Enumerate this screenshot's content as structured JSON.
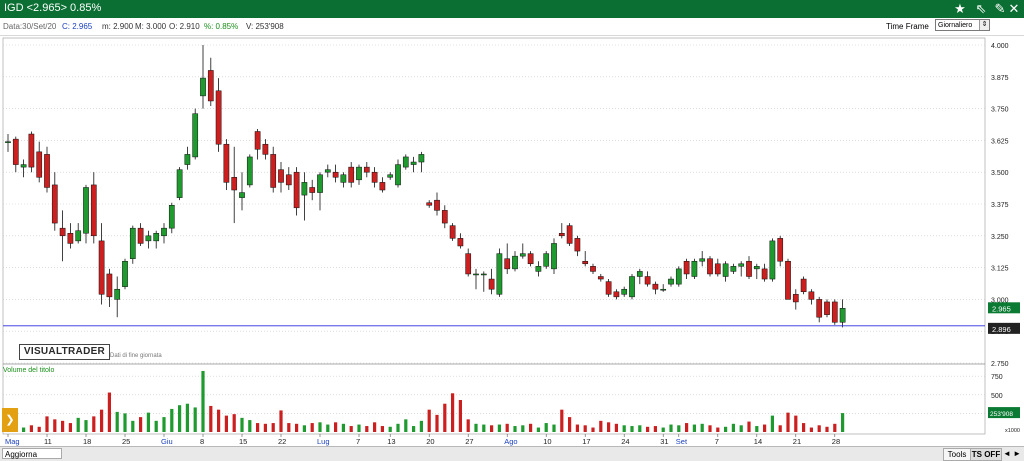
{
  "title": {
    "text": "IGD <2.965> 0.85%"
  },
  "infobar": {
    "date": "Data:30/Set/20",
    "close": "C: 2.965",
    "min": "m: 2.900",
    "max": "M: 3.000",
    "open": "O: 2.910",
    "pct": "%: 0.85%",
    "vol": "V: 253'908"
  },
  "timeframe": {
    "label": "Time Frame",
    "value": "Giornaliero"
  },
  "brand": {
    "name": "VISUALTRADER",
    "subtitle": "Dati di fine giornata"
  },
  "volume_label": "Volume del titolo",
  "price_axis": {
    "ticks": [
      "4.000",
      "3.875",
      "3.750",
      "3.625",
      "3.500",
      "3.375",
      "3.250",
      "3.125",
      "3.000",
      "2.875",
      "2.750"
    ]
  },
  "volume_axis": {
    "ticks": [
      "750",
      "500",
      "250"
    ],
    "unit": "x1000",
    "last_value": "253'908"
  },
  "tags": {
    "last_price": "2.965",
    "crosshair_price": "2.896"
  },
  "date_labels": [
    {
      "t": "Mag",
      "i": 0,
      "month": true
    },
    {
      "t": "11",
      "i": 5
    },
    {
      "t": "18",
      "i": 10
    },
    {
      "t": "25",
      "i": 15
    },
    {
      "t": "Giu",
      "i": 20,
      "month": true
    },
    {
      "t": "8",
      "i": 25
    },
    {
      "t": "15",
      "i": 30
    },
    {
      "t": "22",
      "i": 35
    },
    {
      "t": "Lug",
      "i": 40,
      "month": true
    },
    {
      "t": "7",
      "i": 45
    },
    {
      "t": "13",
      "i": 49
    },
    {
      "t": "20",
      "i": 54
    },
    {
      "t": "27",
      "i": 59
    },
    {
      "t": "Ago",
      "i": 64,
      "month": true
    },
    {
      "t": "10",
      "i": 69
    },
    {
      "t": "17",
      "i": 74
    },
    {
      "t": "24",
      "i": 79
    },
    {
      "t": "31",
      "i": 84
    },
    {
      "t": "Set",
      "i": 86,
      "month": true
    },
    {
      "t": "7",
      "i": 91
    },
    {
      "t": "14",
      "i": 96
    },
    {
      "t": "21",
      "i": 101
    },
    {
      "t": "28",
      "i": 106
    }
  ],
  "bottombar": {
    "aggiorna": "Aggiorna",
    "tools": "Tools",
    "ts_off": "TS OFF",
    "arrows": "◄ ►"
  },
  "colors": {
    "up": "#1e9a2f",
    "down": "#cc1f1f",
    "titlebar": "#0b6f33",
    "crosshair": "#2a2adf",
    "grid": "#c8c8c8"
  },
  "chart_data": {
    "type": "candlestick",
    "ylim": [
      2.75,
      4.0
    ],
    "volume_ylim": [
      0,
      900
    ],
    "candles": [
      {
        "o": 3.62,
        "h": 3.65,
        "l": 3.58,
        "c": 3.62,
        "v": 120
      },
      {
        "o": 3.63,
        "h": 3.64,
        "l": 3.5,
        "c": 3.53,
        "v": 40
      },
      {
        "o": 3.52,
        "h": 3.55,
        "l": 3.48,
        "c": 3.53,
        "v": 60
      },
      {
        "o": 3.65,
        "h": 3.66,
        "l": 3.5,
        "c": 3.52,
        "v": 90
      },
      {
        "o": 3.58,
        "h": 3.62,
        "l": 3.46,
        "c": 3.48,
        "v": 70
      },
      {
        "o": 3.57,
        "h": 3.6,
        "l": 3.42,
        "c": 3.44,
        "v": 210
      },
      {
        "o": 3.45,
        "h": 3.5,
        "l": 3.27,
        "c": 3.3,
        "v": 170
      },
      {
        "o": 3.28,
        "h": 3.35,
        "l": 3.15,
        "c": 3.25,
        "v": 150
      },
      {
        "o": 3.26,
        "h": 3.3,
        "l": 3.2,
        "c": 3.22,
        "v": 120
      },
      {
        "o": 3.23,
        "h": 3.3,
        "l": 3.22,
        "c": 3.27,
        "v": 190
      },
      {
        "o": 3.26,
        "h": 3.45,
        "l": 3.22,
        "c": 3.44,
        "v": 160
      },
      {
        "o": 3.45,
        "h": 3.5,
        "l": 3.22,
        "c": 3.25,
        "v": 210
      },
      {
        "o": 3.23,
        "h": 3.3,
        "l": 2.98,
        "c": 3.02,
        "v": 300
      },
      {
        "o": 3.1,
        "h": 3.12,
        "l": 2.97,
        "c": 3.01,
        "v": 530
      },
      {
        "o": 3.0,
        "h": 3.09,
        "l": 2.93,
        "c": 3.04,
        "v": 270
      },
      {
        "o": 3.05,
        "h": 3.16,
        "l": 3.04,
        "c": 3.15,
        "v": 250
      },
      {
        "o": 3.16,
        "h": 3.29,
        "l": 3.14,
        "c": 3.28,
        "v": 150
      },
      {
        "o": 3.28,
        "h": 3.3,
        "l": 3.21,
        "c": 3.22,
        "v": 200
      },
      {
        "o": 3.23,
        "h": 3.27,
        "l": 3.2,
        "c": 3.25,
        "v": 260
      },
      {
        "o": 3.23,
        "h": 3.27,
        "l": 3.2,
        "c": 3.26,
        "v": 150
      },
      {
        "o": 3.25,
        "h": 3.3,
        "l": 3.22,
        "c": 3.28,
        "v": 200
      },
      {
        "o": 3.28,
        "h": 3.38,
        "l": 3.26,
        "c": 3.37,
        "v": 310
      },
      {
        "o": 3.4,
        "h": 3.52,
        "l": 3.39,
        "c": 3.51,
        "v": 360
      },
      {
        "o": 3.53,
        "h": 3.6,
        "l": 3.51,
        "c": 3.57,
        "v": 380
      },
      {
        "o": 3.56,
        "h": 3.75,
        "l": 3.55,
        "c": 3.73,
        "v": 330
      },
      {
        "o": 3.8,
        "h": 4.0,
        "l": 3.75,
        "c": 3.87,
        "v": 820
      },
      {
        "o": 3.9,
        "h": 3.95,
        "l": 3.76,
        "c": 3.78,
        "v": 350
      },
      {
        "o": 3.82,
        "h": 3.87,
        "l": 3.58,
        "c": 3.61,
        "v": 300
      },
      {
        "o": 3.61,
        "h": 3.63,
        "l": 3.43,
        "c": 3.46,
        "v": 220
      },
      {
        "o": 3.48,
        "h": 3.6,
        "l": 3.3,
        "c": 3.43,
        "v": 240
      },
      {
        "o": 3.4,
        "h": 3.5,
        "l": 3.35,
        "c": 3.42,
        "v": 190
      },
      {
        "o": 3.45,
        "h": 3.57,
        "l": 3.44,
        "c": 3.56,
        "v": 160
      },
      {
        "o": 3.66,
        "h": 3.67,
        "l": 3.55,
        "c": 3.59,
        "v": 120
      },
      {
        "o": 3.61,
        "h": 3.63,
        "l": 3.55,
        "c": 3.57,
        "v": 110
      },
      {
        "o": 3.57,
        "h": 3.6,
        "l": 3.42,
        "c": 3.44,
        "v": 120
      },
      {
        "o": 3.51,
        "h": 3.54,
        "l": 3.42,
        "c": 3.46,
        "v": 290
      },
      {
        "o": 3.49,
        "h": 3.52,
        "l": 3.43,
        "c": 3.45,
        "v": 120
      },
      {
        "o": 3.5,
        "h": 3.52,
        "l": 3.33,
        "c": 3.36,
        "v": 110
      },
      {
        "o": 3.41,
        "h": 3.5,
        "l": 3.31,
        "c": 3.46,
        "v": 90
      },
      {
        "o": 3.44,
        "h": 3.47,
        "l": 3.39,
        "c": 3.42,
        "v": 120
      },
      {
        "o": 3.42,
        "h": 3.5,
        "l": 3.35,
        "c": 3.49,
        "v": 130
      },
      {
        "o": 3.5,
        "h": 3.53,
        "l": 3.48,
        "c": 3.51,
        "v": 100
      },
      {
        "o": 3.5,
        "h": 3.53,
        "l": 3.46,
        "c": 3.48,
        "v": 130
      },
      {
        "o": 3.46,
        "h": 3.5,
        "l": 3.44,
        "c": 3.49,
        "v": 110
      },
      {
        "o": 3.52,
        "h": 3.54,
        "l": 3.44,
        "c": 3.46,
        "v": 80
      },
      {
        "o": 3.47,
        "h": 3.53,
        "l": 3.45,
        "c": 3.52,
        "v": 100
      },
      {
        "o": 3.52,
        "h": 3.54,
        "l": 3.48,
        "c": 3.5,
        "v": 80
      },
      {
        "o": 3.5,
        "h": 3.52,
        "l": 3.44,
        "c": 3.46,
        "v": 130
      },
      {
        "o": 3.46,
        "h": 3.48,
        "l": 3.42,
        "c": 3.43,
        "v": 80
      },
      {
        "o": 3.48,
        "h": 3.5,
        "l": 3.47,
        "c": 3.49,
        "v": 70
      },
      {
        "o": 3.45,
        "h": 3.55,
        "l": 3.44,
        "c": 3.53,
        "v": 110
      },
      {
        "o": 3.52,
        "h": 3.57,
        "l": 3.51,
        "c": 3.56,
        "v": 170
      },
      {
        "o": 3.53,
        "h": 3.56,
        "l": 3.5,
        "c": 3.54,
        "v": 80
      },
      {
        "o": 3.54,
        "h": 3.58,
        "l": 3.5,
        "c": 3.57,
        "v": 150
      },
      {
        "o": 3.38,
        "h": 3.39,
        "l": 3.36,
        "c": 3.37,
        "v": 300
      },
      {
        "o": 3.39,
        "h": 3.42,
        "l": 3.33,
        "c": 3.35,
        "v": 230
      },
      {
        "o": 3.35,
        "h": 3.37,
        "l": 3.28,
        "c": 3.3,
        "v": 380
      },
      {
        "o": 3.29,
        "h": 3.3,
        "l": 3.23,
        "c": 3.24,
        "v": 520
      },
      {
        "o": 3.24,
        "h": 3.26,
        "l": 3.2,
        "c": 3.21,
        "v": 430
      },
      {
        "o": 3.18,
        "h": 3.2,
        "l": 3.09,
        "c": 3.1,
        "v": 170
      },
      {
        "o": 3.1,
        "h": 3.12,
        "l": 3.04,
        "c": 3.1,
        "v": 110
      },
      {
        "o": 3.1,
        "h": 3.11,
        "l": 3.03,
        "c": 3.1,
        "v": 100
      },
      {
        "o": 3.08,
        "h": 3.12,
        "l": 3.02,
        "c": 3.04,
        "v": 90
      },
      {
        "o": 3.02,
        "h": 3.2,
        "l": 3.01,
        "c": 3.18,
        "v": 100
      },
      {
        "o": 3.16,
        "h": 3.22,
        "l": 3.1,
        "c": 3.12,
        "v": 110
      },
      {
        "o": 3.12,
        "h": 3.19,
        "l": 3.11,
        "c": 3.17,
        "v": 80
      },
      {
        "o": 3.17,
        "h": 3.22,
        "l": 3.16,
        "c": 3.18,
        "v": 90
      },
      {
        "o": 3.18,
        "h": 3.19,
        "l": 3.13,
        "c": 3.14,
        "v": 110
      },
      {
        "o": 3.11,
        "h": 3.15,
        "l": 3.09,
        "c": 3.13,
        "v": 60
      },
      {
        "o": 3.13,
        "h": 3.19,
        "l": 3.12,
        "c": 3.18,
        "v": 120
      },
      {
        "o": 3.12,
        "h": 3.24,
        "l": 3.1,
        "c": 3.22,
        "v": 100
      },
      {
        "o": 3.26,
        "h": 3.3,
        "l": 3.24,
        "c": 3.25,
        "v": 300
      },
      {
        "o": 3.29,
        "h": 3.3,
        "l": 3.21,
        "c": 3.22,
        "v": 200
      },
      {
        "o": 3.24,
        "h": 3.25,
        "l": 3.17,
        "c": 3.19,
        "v": 100
      },
      {
        "o": 3.15,
        "h": 3.19,
        "l": 3.13,
        "c": 3.14,
        "v": 90
      },
      {
        "o": 3.13,
        "h": 3.14,
        "l": 3.1,
        "c": 3.11,
        "v": 60
      },
      {
        "o": 3.09,
        "h": 3.1,
        "l": 3.07,
        "c": 3.08,
        "v": 150
      },
      {
        "o": 3.07,
        "h": 3.08,
        "l": 3.01,
        "c": 3.02,
        "v": 130
      },
      {
        "o": 3.03,
        "h": 3.04,
        "l": 3.0,
        "c": 3.01,
        "v": 110
      },
      {
        "o": 3.02,
        "h": 3.05,
        "l": 3.01,
        "c": 3.04,
        "v": 90
      },
      {
        "o": 3.01,
        "h": 3.1,
        "l": 3.0,
        "c": 3.09,
        "v": 80
      },
      {
        "o": 3.09,
        "h": 3.12,
        "l": 3.06,
        "c": 3.11,
        "v": 90
      },
      {
        "o": 3.09,
        "h": 3.11,
        "l": 3.05,
        "c": 3.06,
        "v": 70
      },
      {
        "o": 3.06,
        "h": 3.07,
        "l": 3.02,
        "c": 3.04,
        "v": 80
      },
      {
        "o": 3.04,
        "h": 3.06,
        "l": 3.03,
        "c": 3.04,
        "v": 60
      },
      {
        "o": 3.06,
        "h": 3.09,
        "l": 3.05,
        "c": 3.08,
        "v": 100
      },
      {
        "o": 3.06,
        "h": 3.13,
        "l": 3.05,
        "c": 3.12,
        "v": 90
      },
      {
        "o": 3.15,
        "h": 3.16,
        "l": 3.08,
        "c": 3.1,
        "v": 120
      },
      {
        "o": 3.09,
        "h": 3.16,
        "l": 3.08,
        "c": 3.15,
        "v": 100
      },
      {
        "o": 3.15,
        "h": 3.19,
        "l": 3.13,
        "c": 3.16,
        "v": 110
      },
      {
        "o": 3.16,
        "h": 3.17,
        "l": 3.09,
        "c": 3.1,
        "v": 90
      },
      {
        "o": 3.14,
        "h": 3.16,
        "l": 3.09,
        "c": 3.1,
        "v": 60
      },
      {
        "o": 3.09,
        "h": 3.15,
        "l": 3.07,
        "c": 3.14,
        "v": 70
      },
      {
        "o": 3.11,
        "h": 3.14,
        "l": 3.1,
        "c": 3.13,
        "v": 110
      },
      {
        "o": 3.13,
        "h": 3.15,
        "l": 3.09,
        "c": 3.14,
        "v": 90
      },
      {
        "o": 3.15,
        "h": 3.17,
        "l": 3.08,
        "c": 3.09,
        "v": 140
      },
      {
        "o": 3.12,
        "h": 3.14,
        "l": 3.08,
        "c": 3.13,
        "v": 80
      },
      {
        "o": 3.12,
        "h": 3.14,
        "l": 3.07,
        "c": 3.08,
        "v": 100
      },
      {
        "o": 3.08,
        "h": 3.24,
        "l": 3.07,
        "c": 3.23,
        "v": 220
      },
      {
        "o": 3.24,
        "h": 3.25,
        "l": 3.13,
        "c": 3.15,
        "v": 90
      },
      {
        "o": 3.15,
        "h": 3.16,
        "l": 3.0,
        "c": 3.0,
        "v": 260
      },
      {
        "o": 3.02,
        "h": 3.04,
        "l": 2.96,
        "c": 2.99,
        "v": 220
      },
      {
        "o": 3.08,
        "h": 3.09,
        "l": 3.02,
        "c": 3.03,
        "v": 120
      },
      {
        "o": 3.03,
        "h": 3.04,
        "l": 2.98,
        "c": 3.0,
        "v": 60
      },
      {
        "o": 3.0,
        "h": 3.01,
        "l": 2.91,
        "c": 2.93,
        "v": 90
      },
      {
        "o": 2.99,
        "h": 3.0,
        "l": 2.93,
        "c": 2.94,
        "v": 70
      },
      {
        "o": 2.99,
        "h": 3.0,
        "l": 2.9,
        "c": 2.91,
        "v": 110
      },
      {
        "o": 2.91,
        "h": 3.0,
        "l": 2.89,
        "c": 2.965,
        "v": 254
      }
    ]
  }
}
